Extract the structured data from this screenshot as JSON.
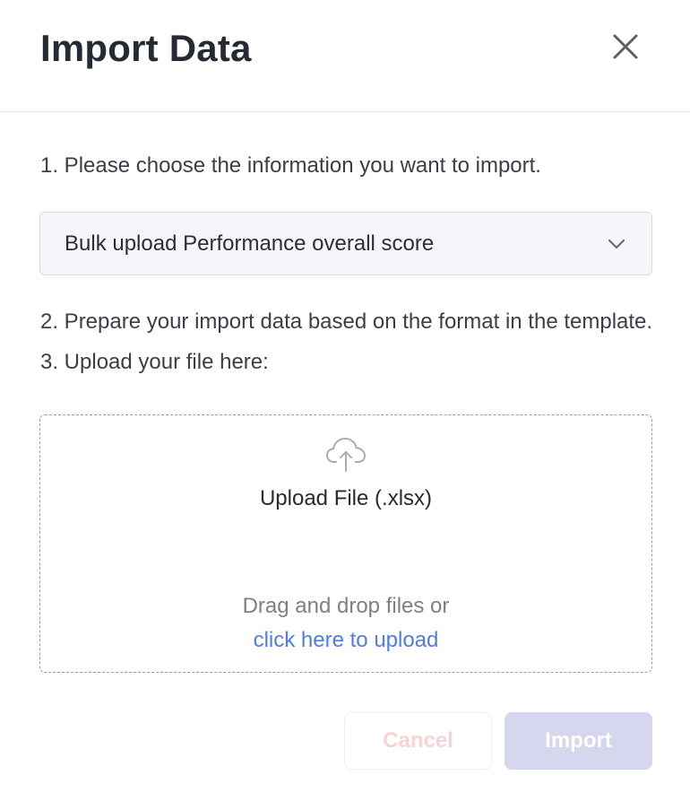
{
  "dialog": {
    "title": "Import Data",
    "close_icon": "close-icon"
  },
  "steps": {
    "step1": "1. Please choose the information you want to import.",
    "step2": "2. Prepare your import data based on the format in the template.",
    "step3": "3. Upload your file here:"
  },
  "select": {
    "value": "Bulk upload Performance overall score",
    "icon": "chevron-down-icon"
  },
  "dropzone": {
    "icon": "cloud-upload-icon",
    "title": "Upload File (.xlsx)",
    "drag_text": "Drag and drop files or",
    "link_text": "click here to upload"
  },
  "buttons": {
    "cancel": "Cancel",
    "import": "Import"
  },
  "colors": {
    "link": "#4f7ee0",
    "import_button_disabled": "#d6d6ee",
    "cancel_text_disabled": "#f7d3d5",
    "select_background": "#f6f6fa"
  }
}
